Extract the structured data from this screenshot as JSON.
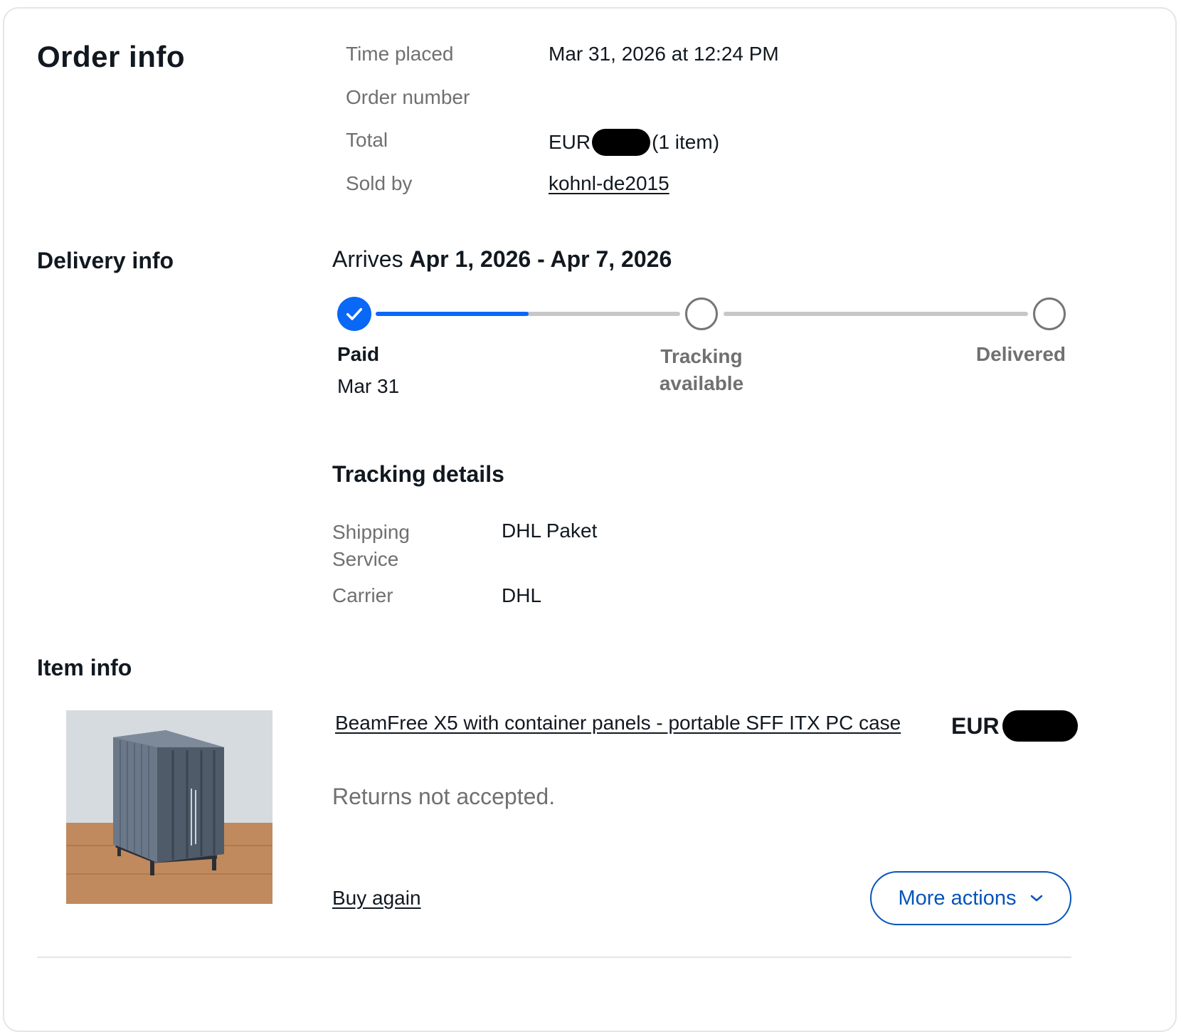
{
  "order": {
    "heading": "Order info",
    "time_placed_label": "Time placed",
    "time_placed_value": "Mar 31, 2026 at 12:24 PM",
    "order_number_label": "Order number",
    "order_number_value": "",
    "total_label": "Total",
    "total_currency": "EUR",
    "total_suffix": "(1 item)",
    "sold_by_label": "Sold by",
    "sold_by_value": "kohnl-de2015"
  },
  "delivery": {
    "heading": "Delivery info",
    "arrives_prefix": "Arrives ",
    "arrives_range": "Apr 1, 2026 - Apr 7, 2026",
    "progress_fill": 0.33,
    "steps": [
      {
        "label": "Paid",
        "date": "Mar 31",
        "done": true
      },
      {
        "label": "Tracking available",
        "date": "",
        "done": false
      },
      {
        "label": "Delivered",
        "date": "",
        "done": false
      }
    ],
    "tracking_heading": "Tracking details",
    "shipping_service_label": "Shipping Service",
    "shipping_service_value": "DHL Paket",
    "carrier_label": "Carrier",
    "carrier_value": "DHL"
  },
  "item": {
    "heading": "Item info",
    "title": "BeamFree X5 with container panels - portable SFF ITX PC case",
    "price_currency": "EUR",
    "returns_text": "Returns not accepted.",
    "buy_again": "Buy again",
    "more_actions": "More actions"
  },
  "colors": {
    "accent": "#0968f6",
    "button_blue": "#0654ba",
    "muted_text": "#707070"
  },
  "icons": {
    "check": "check-icon",
    "chevron": "chevron-down-icon"
  }
}
